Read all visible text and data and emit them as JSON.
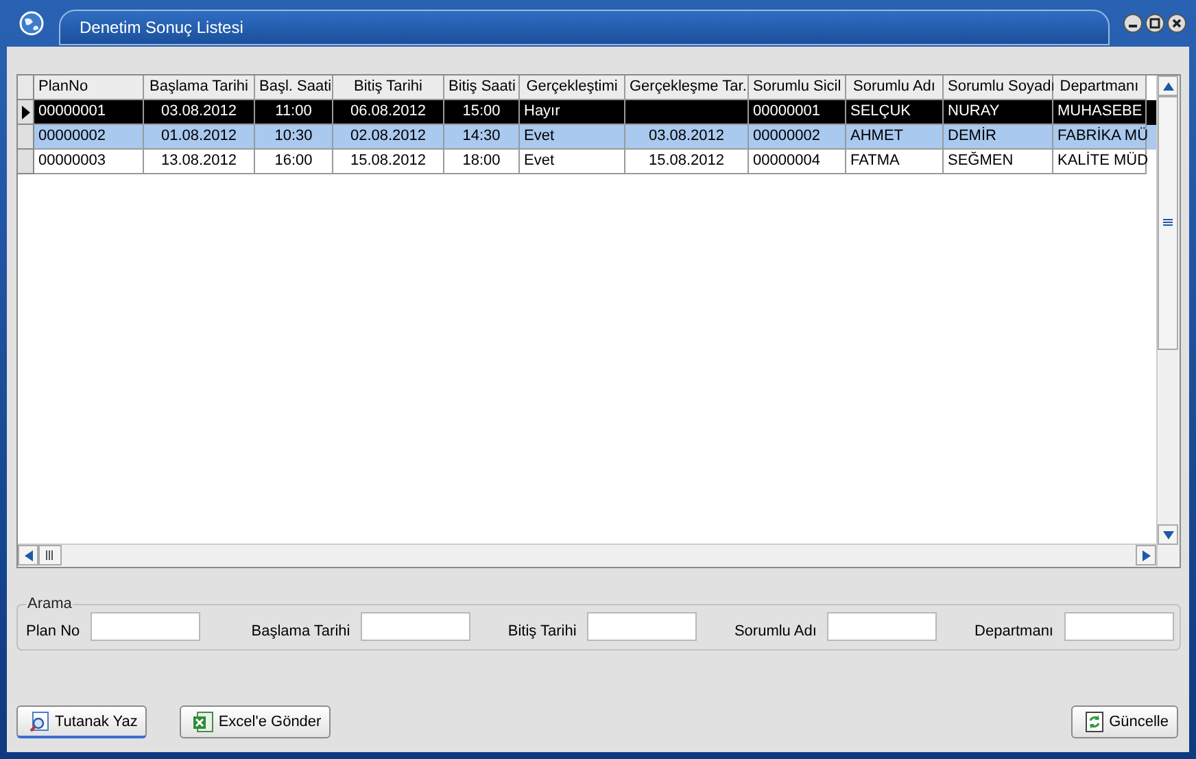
{
  "window": {
    "title": "Denetim Sonuç Listesi"
  },
  "table": {
    "columns": [
      {
        "label": "PlanNo",
        "kind": "text"
      },
      {
        "label": "Başlama Tarihi",
        "kind": "date"
      },
      {
        "label": "Başl. Saati",
        "kind": "time"
      },
      {
        "label": "Bitiş Tarihi",
        "kind": "date"
      },
      {
        "label": "Bitiş Saati",
        "kind": "time"
      },
      {
        "label": "Gerçekleştimi",
        "kind": "text"
      },
      {
        "label": "Gerçekleşme Tar.",
        "kind": "date"
      },
      {
        "label": "Sorumlu Sicil",
        "kind": "text"
      },
      {
        "label": "Sorumlu Adı",
        "kind": "text"
      },
      {
        "label": "Sorumlu Soyadı",
        "kind": "text"
      },
      {
        "label": "Departmanı",
        "kind": "text"
      }
    ],
    "rows": [
      {
        "current": true,
        "selected": true,
        "cells": [
          "00000001",
          "03.08.2012",
          "11:00",
          "06.08.2012",
          "15:00",
          "Hayır",
          "",
          "00000001",
          "SELÇUK",
          "NURAY",
          "MUHASEBE"
        ]
      },
      {
        "current": false,
        "selected": true,
        "cells": [
          "00000002",
          "01.08.2012",
          "10:30",
          "02.08.2012",
          "14:30",
          "Evet",
          "03.08.2012",
          "00000002",
          "AHMET",
          "DEMİR",
          "FABRİKA MÜ"
        ]
      },
      {
        "current": false,
        "selected": false,
        "cells": [
          "00000003",
          "13.08.2012",
          "16:00",
          "15.08.2012",
          "18:00",
          "Evet",
          "15.08.2012",
          "00000004",
          "FATMA",
          "SEĞMEN",
          "KALİTE MÜD"
        ]
      }
    ]
  },
  "search": {
    "title": "Arama",
    "fields": [
      {
        "label": "Plan No"
      },
      {
        "label": "Başlama Tarihi"
      },
      {
        "label": "Bitiş Tarihi"
      },
      {
        "label": "Sorumlu Adı"
      },
      {
        "label": "Departmanı"
      }
    ]
  },
  "buttons": [
    {
      "kind": "report",
      "label": "Tutanak Yaz"
    },
    {
      "kind": "excel",
      "label": "Excel'e Gönder"
    },
    {
      "kind": "refresh",
      "label": "Güncelle"
    }
  ]
}
